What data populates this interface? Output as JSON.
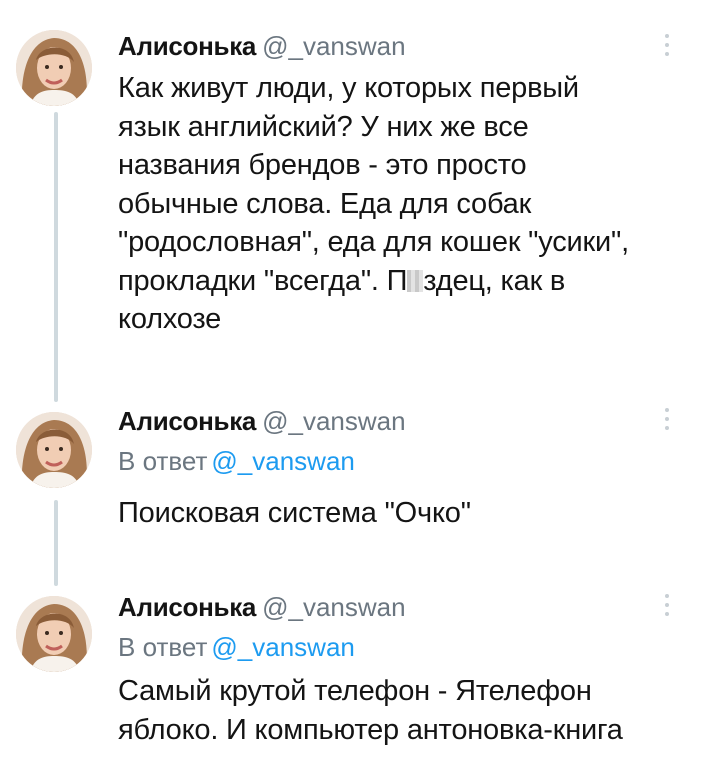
{
  "tweets": [
    {
      "name": "Алисонька",
      "handle": "@_vanswan",
      "text_before_censor": "Как живут люди, у которых первый\nязык английский? У них же все\nназвания брендов - это просто\nобычные слова. Еда для собак\n\"родословная\", еда для кошек \"усики\",\nпрокладки \"всегда\". П",
      "text_after_censor": "здец, как в\nколхозе"
    },
    {
      "name": "Алисонька",
      "handle": "@_vanswan",
      "reply_prefix": "В ответ",
      "reply_to": "@_vanswan",
      "text": "Поисковая система \"Очко\""
    },
    {
      "name": "Алисонька",
      "handle": "@_vanswan",
      "reply_prefix": "В ответ",
      "reply_to": "@_vanswan",
      "text": "Самый крутой телефон - Ятелефон\nяблоко. И компьютер антоновка-книга"
    }
  ],
  "icons": {
    "more": "more-vertical-icon",
    "avatar": "user-avatar-photo"
  },
  "colors": {
    "name": "#141414",
    "handle": "#6b7680",
    "mention": "#1d9bf0",
    "thread_line": "#cfd9de"
  }
}
